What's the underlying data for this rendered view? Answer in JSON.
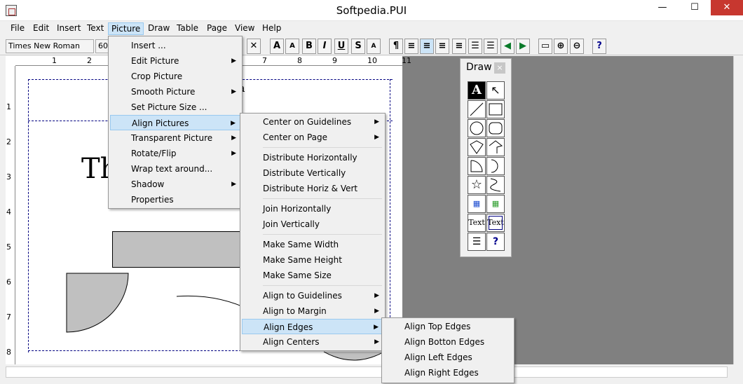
{
  "window": {
    "title": "Softpedia.PUI",
    "minimize": "—",
    "maximize": "☐",
    "close": "✕"
  },
  "menubar": [
    "File",
    "Edit",
    "Insert",
    "Text",
    "Picture",
    "Draw",
    "Table",
    "Page",
    "View",
    "Help"
  ],
  "toolbar": {
    "font": "Times New Roman",
    "size": "60"
  },
  "ruler": {
    "h": [
      "1",
      "2",
      "7",
      "8",
      "9",
      "10",
      "11"
    ],
    "v": [
      "1",
      "2",
      "3",
      "4",
      "5",
      "6",
      "7",
      "8"
    ]
  },
  "doc": {
    "text": "Th",
    "text2": "a"
  },
  "picture_menu": [
    {
      "label": "Insert ...",
      "sub": false
    },
    {
      "label": "Edit Picture",
      "sub": true
    },
    {
      "label": "Crop Picture",
      "sub": false
    },
    {
      "label": "Smooth Picture",
      "sub": true
    },
    {
      "label": "Set Picture Size ...",
      "sub": false
    },
    {
      "label": "Align Pictures",
      "sub": true
    },
    {
      "label": "Transparent Picture",
      "sub": true
    },
    {
      "label": "Rotate/Flip",
      "sub": true
    },
    {
      "label": "Wrap text around...",
      "sub": false
    },
    {
      "label": "Shadow",
      "sub": true
    },
    {
      "label": "Properties",
      "sub": false
    }
  ],
  "align_menu": [
    {
      "label": "Center on Guidelines",
      "sub": true
    },
    {
      "label": "Center on Page",
      "sub": true
    },
    {
      "label": "Distribute Horizontally",
      "sub": false
    },
    {
      "label": "Distribute Vertically",
      "sub": false
    },
    {
      "label": "Distribute Horiz & Vert",
      "sub": false
    },
    {
      "label": "Join Horizontally",
      "sub": false
    },
    {
      "label": "Join Vertically",
      "sub": false
    },
    {
      "label": "Make Same Width",
      "sub": false
    },
    {
      "label": "Make Same Height",
      "sub": false
    },
    {
      "label": "Make Same Size",
      "sub": false
    },
    {
      "label": "Align to Guidelines",
      "sub": true
    },
    {
      "label": "Align to Margin",
      "sub": true
    },
    {
      "label": "Align Edges",
      "sub": true
    },
    {
      "label": "Align Centers",
      "sub": true
    }
  ],
  "edges_menu": [
    "Align Top Edges",
    "Align Botton Edges",
    "Align Left Edges",
    "Align Right Edges"
  ],
  "draw_palette": {
    "title": "Draw",
    "close": "×",
    "text_tool": "Text",
    "text_box_tool": "Text",
    "help": "?"
  },
  "toolbar_buttons": [
    "A",
    "A",
    "B",
    "I",
    "U",
    "¶",
    "?"
  ]
}
